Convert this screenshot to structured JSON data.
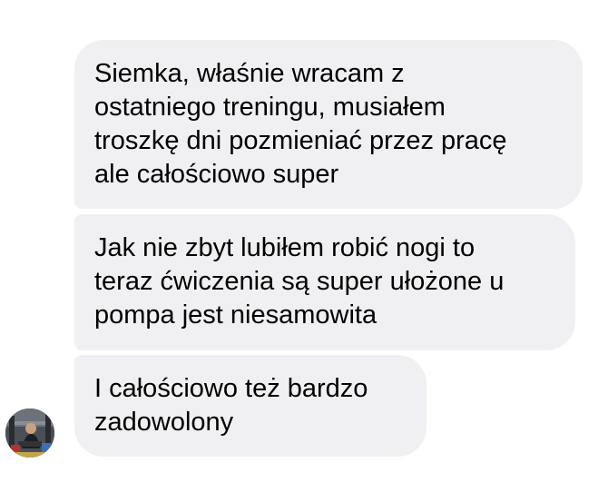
{
  "conversation": {
    "messages": [
      {
        "text": "Siemka, właśnie wracam z\nostatniego treningu, musiałem\ntroszkę dni pozmieniać przez pracę\nale całościowo super"
      },
      {
        "text": "Jak nie zbyt lubiłem robić nogi to\nteraz ćwiczenia są super ułożone u\npompa jest niesamowita"
      },
      {
        "text": "I całościowo też bardzo\nzadowolony"
      }
    ],
    "sender_avatar": {
      "icon": "user-avatar-photo"
    },
    "colors": {
      "bubble_background": "#f0f0f2",
      "text": "#000000",
      "page_background": "#ffffff"
    }
  }
}
